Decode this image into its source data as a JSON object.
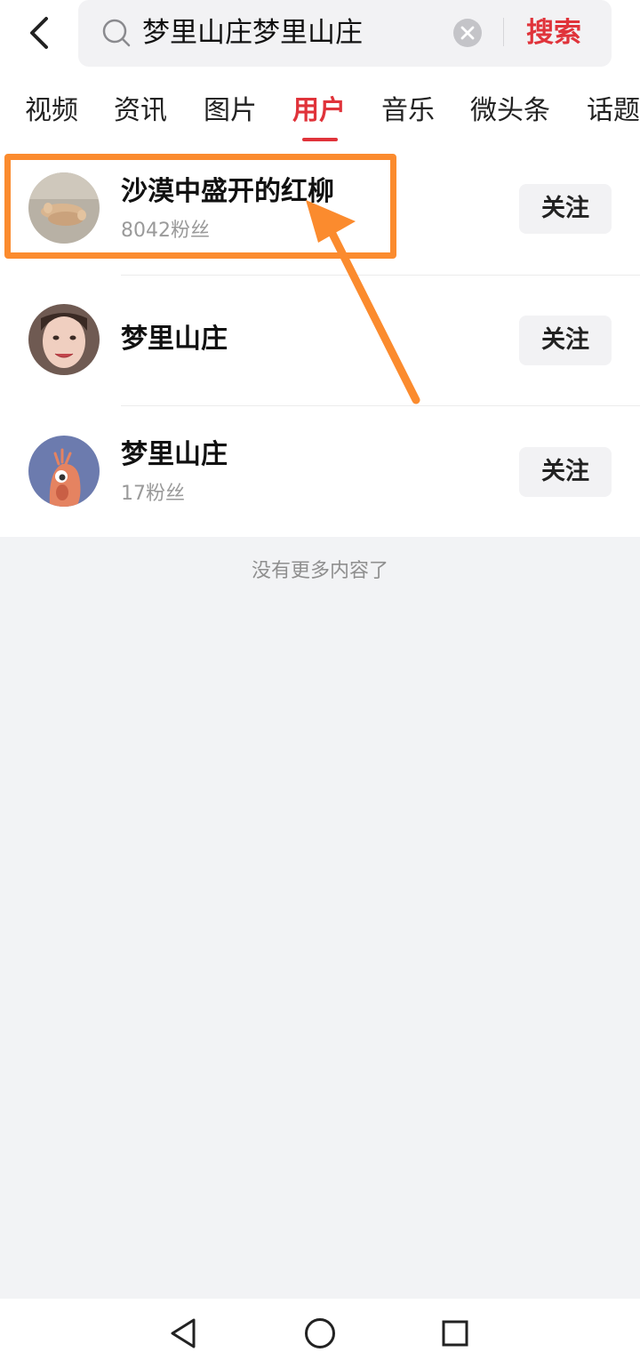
{
  "header": {
    "query": "梦里山庄梦里山庄",
    "search_label": "搜索",
    "colors": {
      "accent": "#e0333a",
      "annotation": "#fb8b2e"
    }
  },
  "tabs": [
    {
      "label": "视频"
    },
    {
      "label": "资讯"
    },
    {
      "label": "图片"
    },
    {
      "label": "用户",
      "active": true
    },
    {
      "label": "音乐"
    },
    {
      "label": "微头条"
    },
    {
      "label": "话题"
    }
  ],
  "results": [
    {
      "name": "沙漠中盛开的红柳",
      "fans": "8042粉丝",
      "follow": "关注",
      "avatar": "photo-avatar"
    },
    {
      "name": "梦里山庄",
      "follow": "关注",
      "avatar": "photo-avatar"
    },
    {
      "name": "梦里山庄",
      "fans": "17粉丝",
      "follow": "关注",
      "avatar": "cartoon-avatar"
    }
  ],
  "footer": {
    "no_more": "没有更多内容了"
  },
  "navbar": {
    "icons": [
      "back-triangle-icon",
      "home-circle-icon",
      "recents-square-icon"
    ]
  }
}
